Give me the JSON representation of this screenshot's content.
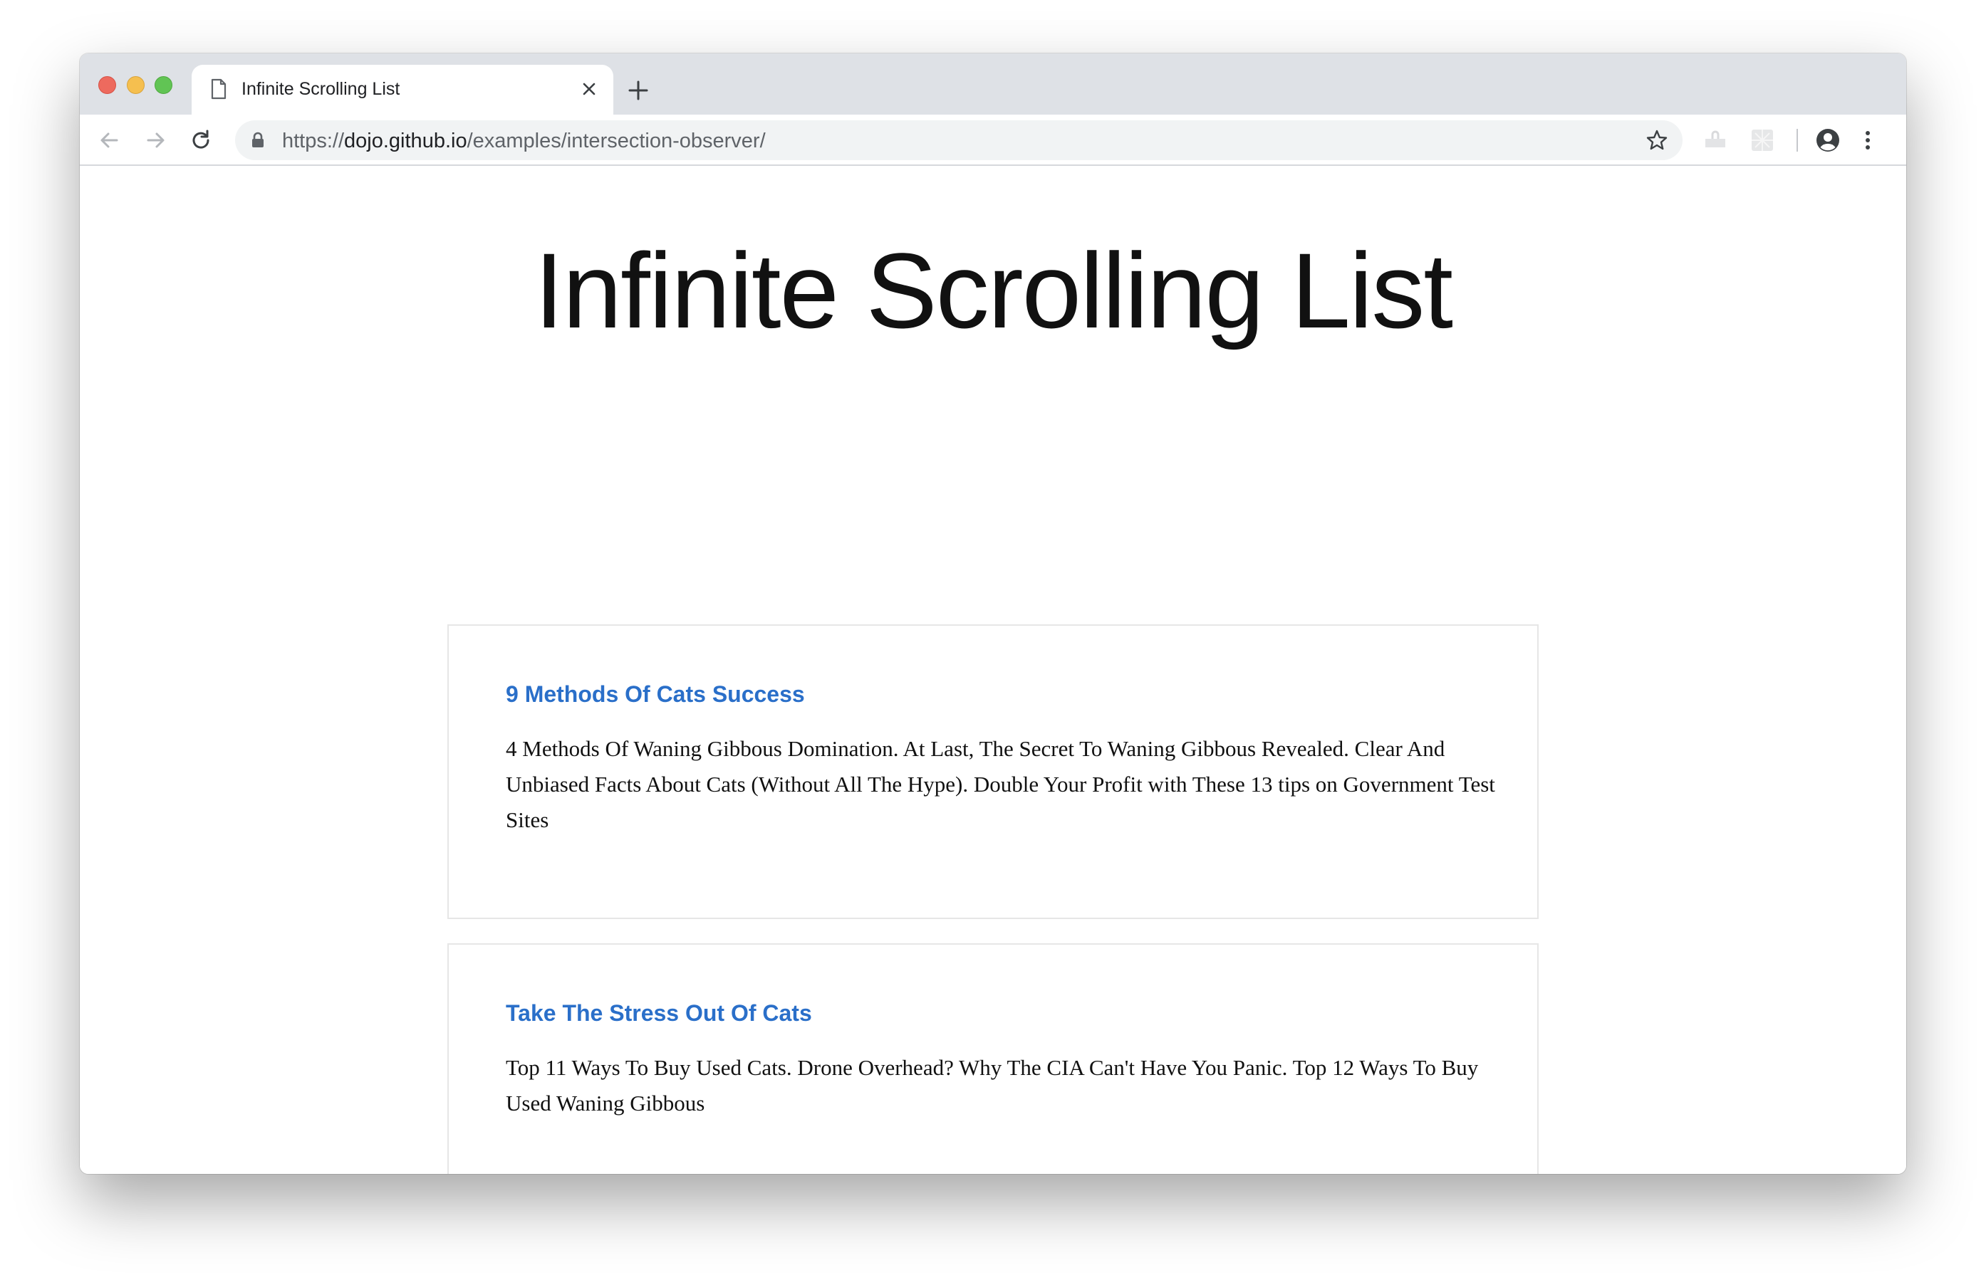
{
  "browser": {
    "tab": {
      "title": "Infinite Scrolling List"
    },
    "address_bar": {
      "scheme": "https://",
      "host": "dojo.github.io",
      "path": "/examples/intersection-observer/"
    },
    "icons": {
      "back": "arrow-left-icon",
      "forward": "arrow-right-icon",
      "reload": "reload-icon",
      "lock": "lock-icon",
      "bookmark": "star-icon",
      "profile": "account-circle-icon",
      "menu": "more-vertical-icon",
      "new_tab": "plus-icon",
      "tab_close": "close-icon",
      "tab_page": "document-icon"
    }
  },
  "page": {
    "title": "Infinite Scrolling List",
    "accent_color": "#2a6fc9",
    "cards": [
      {
        "title": "9 Methods Of Cats Success",
        "body": "4 Methods Of Waning Gibbous Domination. At Last, The Secret To Waning Gibbous Revealed. Clear And Unbiased Facts About Cats (Without All The Hype). Double Your Profit with These 13 tips on Government Test Sites"
      },
      {
        "title": "Take The Stress Out Of Cats",
        "body": "Top 11 Ways To Buy Used Cats. Drone Overhead? Why The CIA Can't Have You Panic. Top 12 Ways To Buy Used Waning Gibbous"
      }
    ]
  }
}
